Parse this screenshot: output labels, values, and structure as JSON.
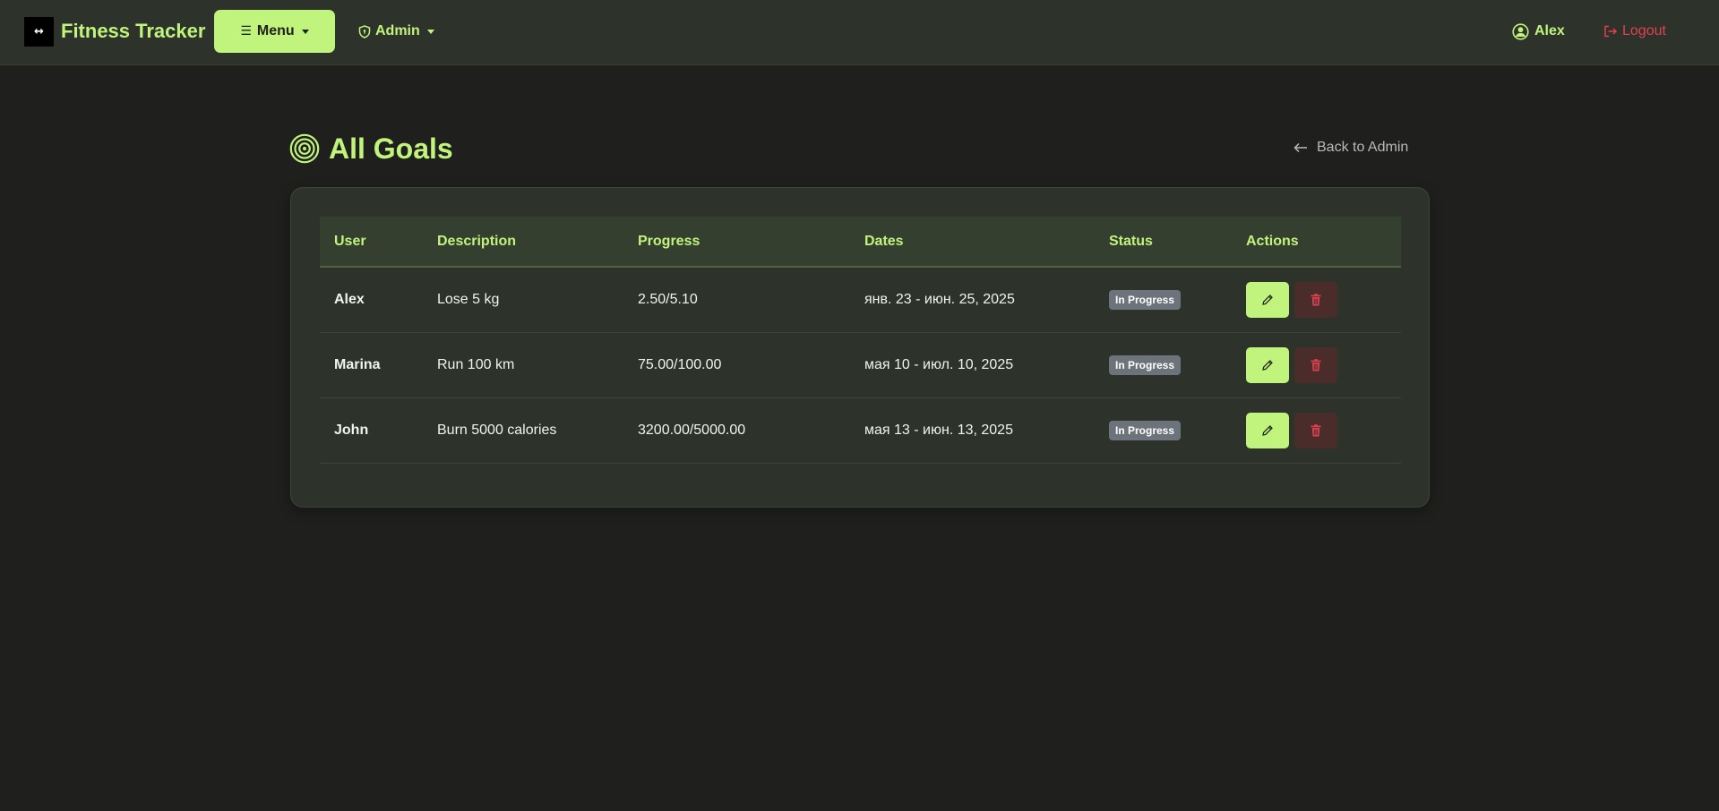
{
  "navbar": {
    "brand": "Fitness Tracker",
    "brand_icon": "dumbbell-icon",
    "brand_glyph": "↔",
    "menu_label": "Menu",
    "admin_label": "Admin",
    "user_name": "Alex",
    "logout_label": "Logout"
  },
  "page": {
    "title": "All Goals",
    "back_label": "Back to Admin"
  },
  "table": {
    "headers": {
      "user": "User",
      "description": "Description",
      "progress": "Progress",
      "dates": "Dates",
      "status": "Status",
      "actions": "Actions"
    },
    "rows": [
      {
        "user": "Alex",
        "description": "Lose 5 kg",
        "progress": "2.50/5.10",
        "dates": "янв. 23 - июн. 25, 2025",
        "status": "In Progress"
      },
      {
        "user": "Marina",
        "description": "Run 100 km",
        "progress": "75.00/100.00",
        "dates": "мая 10 - июл. 10, 2025",
        "status": "In Progress"
      },
      {
        "user": "John",
        "description": "Burn 5000 calories",
        "progress": "3200.00/5000.00",
        "dates": "мая 13 - июн. 13, 2025",
        "status": "In Progress"
      }
    ]
  },
  "colors": {
    "accent": "#c1f47d",
    "background": "#1f1f1d",
    "panel": "#2d332b",
    "danger": "#e0414e",
    "badge": "#6c737b"
  }
}
